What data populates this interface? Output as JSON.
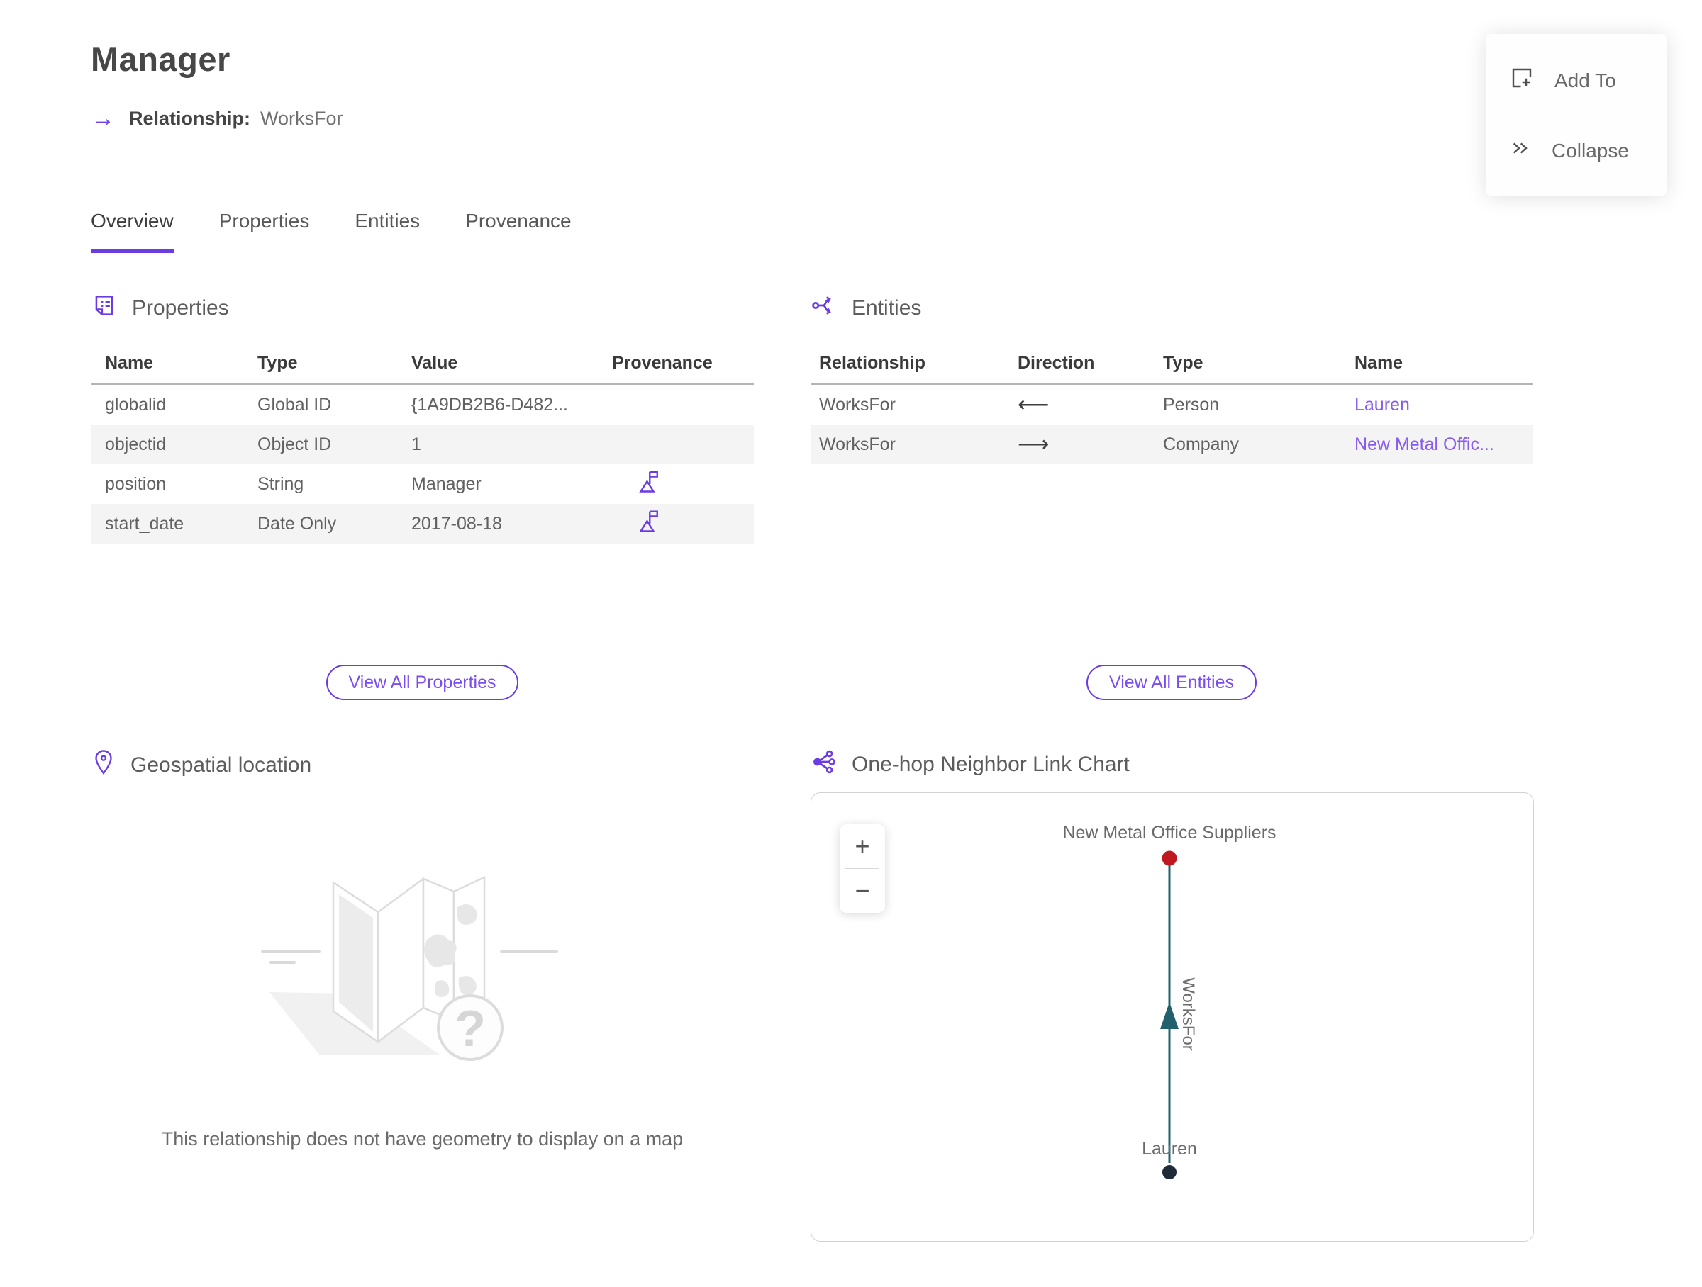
{
  "header": {
    "title": "Manager",
    "relationship_label": "Relationship:",
    "relationship_value": "WorksFor",
    "relationship_arrow_glyph": "→"
  },
  "actions_menu": {
    "add_to_label": "Add To",
    "collapse_label": "Collapse"
  },
  "tabs": {
    "overview": "Overview",
    "properties": "Properties",
    "entities": "Entities",
    "provenance": "Provenance",
    "active_tab": "Overview"
  },
  "properties_section": {
    "title": "Properties",
    "columns": {
      "name": "Name",
      "type": "Type",
      "value": "Value",
      "provenance": "Provenance"
    },
    "rows": [
      {
        "name": "globalid",
        "type": "Global ID",
        "value": "{1A9DB2B6-D482...",
        "has_provenance": false
      },
      {
        "name": "objectid",
        "type": "Object ID",
        "value": "1",
        "has_provenance": false
      },
      {
        "name": "position",
        "type": "String",
        "value": "Manager",
        "has_provenance": true
      },
      {
        "name": "start_date",
        "type": "Date Only",
        "value": "2017-08-18",
        "has_provenance": true
      }
    ],
    "view_all_label": "View All Properties"
  },
  "entities_section": {
    "title": "Entities",
    "columns": {
      "relationship": "Relationship",
      "direction": "Direction",
      "type": "Type",
      "name": "Name"
    },
    "rows": [
      {
        "relationship": "WorksFor",
        "direction": "⟵",
        "type": "Person",
        "name": "Lauren"
      },
      {
        "relationship": "WorksFor",
        "direction": "⟶",
        "type": "Company",
        "name": "New Metal Offic..."
      }
    ],
    "view_all_label": "View All Entities"
  },
  "geospatial_section": {
    "title": "Geospatial location",
    "empty_message": "This relationship does not have geometry to display on a map"
  },
  "link_chart_section": {
    "title": "One-hop Neighbor Link Chart",
    "zoom_in_label": "+",
    "zoom_out_label": "−",
    "graph": {
      "top_node_label": "New Metal Office Suppliers",
      "bottom_node_label": "Lauren",
      "edge_label": "WorksFor",
      "top_node_color": "#C0181F",
      "bottom_node_color": "#1E2B38",
      "edge_color": "#23606E"
    }
  },
  "colors": {
    "accent_purple": "#6B3CE4",
    "link_purple": "#875BF0",
    "active_tab_underline": "#6B3CE4"
  }
}
